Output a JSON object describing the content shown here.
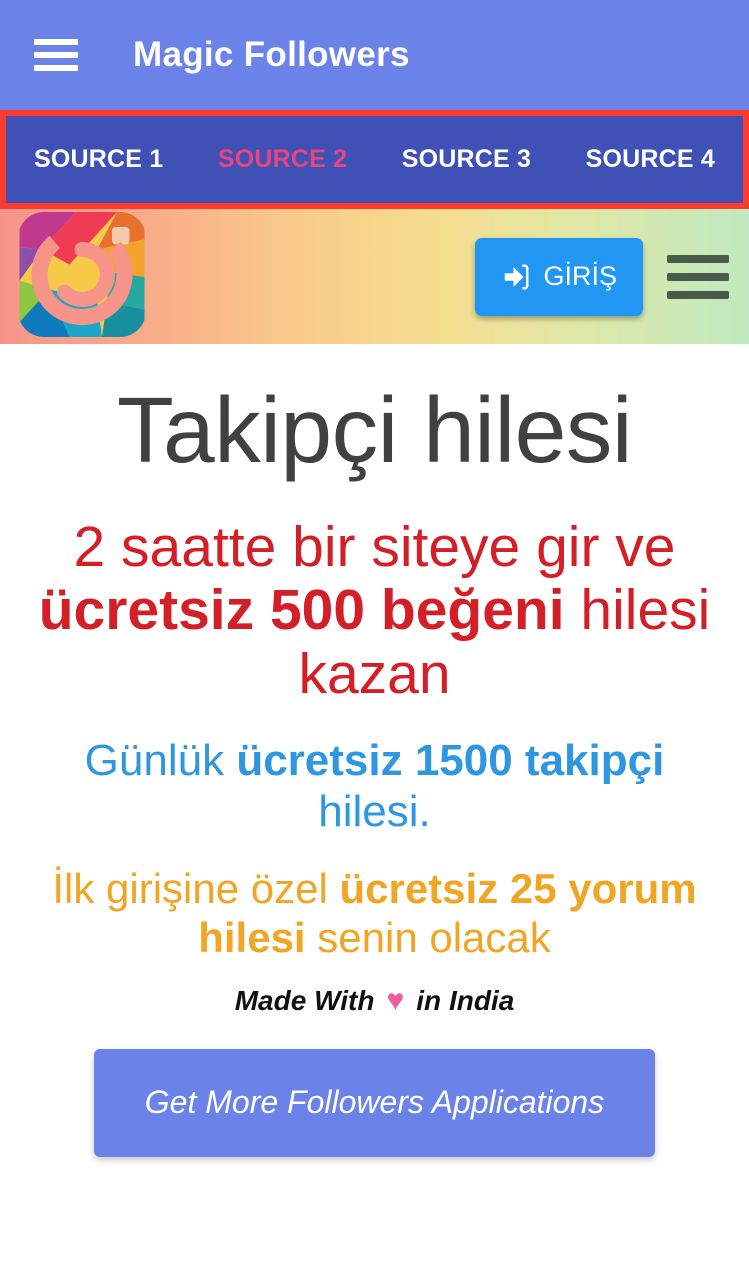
{
  "appbar": {
    "menu_icon": "hamburger-menu-icon",
    "title": "Magic Followers",
    "background": "#6b82e8"
  },
  "tabs": {
    "annotation_color": "#ff3b2f",
    "background": "#3f51b5",
    "active_color": "#e8447f",
    "items": [
      {
        "label": "SOURCE 1",
        "active": false
      },
      {
        "label": "SOURCE 2",
        "active": true
      },
      {
        "label": "SOURCE 3",
        "active": false
      },
      {
        "label": "SOURCE 4",
        "active": false
      }
    ]
  },
  "web_header": {
    "logo_icon": "site-logo-icon",
    "login_button": {
      "label": "GİRİŞ",
      "icon": "sign-in-arrow-icon",
      "color": "#2196f3"
    },
    "menu_icon": "hamburger-menu-icon"
  },
  "content": {
    "heading": "Takipçi hilesi",
    "promo_red": {
      "color": "#d32028",
      "prefix": "2 saatte bir siteye gir ve ",
      "bold": "ücretsiz 500 beğeni",
      "suffix": " hilesi kazan"
    },
    "promo_blue": {
      "color": "#2e97e0",
      "prefix": "Günlük ",
      "bold": "ücretsiz 1500 takipçi",
      "suffix": " hilesi."
    },
    "promo_orange": {
      "color": "#f0a524",
      "prefix": "İlk girişine özel ",
      "bold": "ücretsiz 25 yorum hilesi",
      "suffix": " senin olacak"
    },
    "made_with": {
      "prefix": "Made With",
      "heart": "♥",
      "suffix": "in India",
      "heart_color": "#ef5ba1"
    },
    "cta_label": "Get More Followers Applications",
    "cta_color": "#6b82e8"
  }
}
